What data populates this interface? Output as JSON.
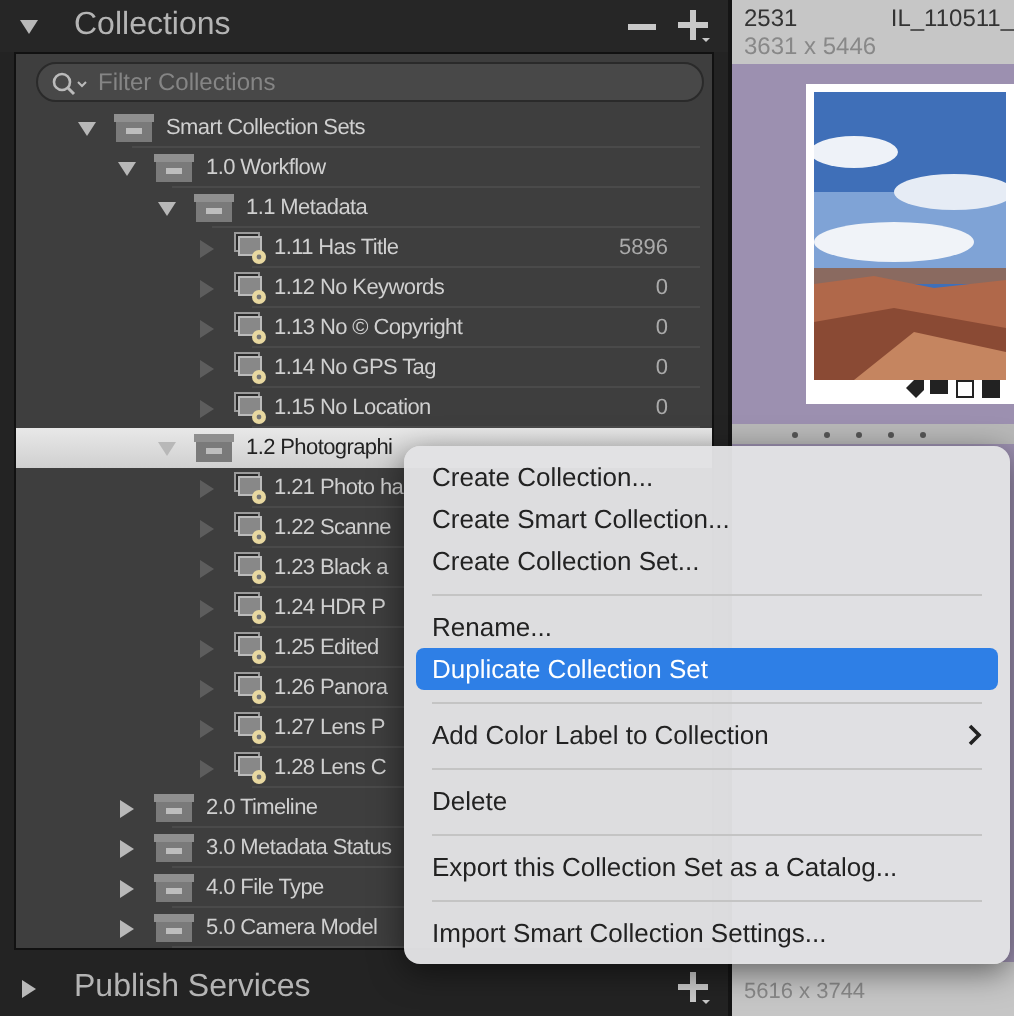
{
  "collections_panel": {
    "title": "Collections",
    "expanded": true,
    "filter": {
      "placeholder": "Filter Collections"
    },
    "tree": [
      {
        "kind": "set",
        "label": "Smart Collection Sets",
        "expanded": true,
        "selected": false,
        "children": [
          {
            "kind": "set",
            "label": "1.0 Workflow",
            "expanded": true,
            "selected": false,
            "children": [
              {
                "kind": "set",
                "label": "1.1 Metadata",
                "expanded": true,
                "selected": false,
                "children": [
                  {
                    "kind": "smart",
                    "label": "1.11 Has Title",
                    "count": "5896",
                    "selected": false
                  },
                  {
                    "kind": "smart",
                    "label": "1.12 No Keywords",
                    "count": "0",
                    "selected": false
                  },
                  {
                    "kind": "smart",
                    "label": "1.13 No © Copyright",
                    "count": "0",
                    "selected": false
                  },
                  {
                    "kind": "smart",
                    "label": "1.14 No GPS Tag",
                    "count": "0",
                    "selected": false
                  },
                  {
                    "kind": "smart",
                    "label": "1.15 No Location",
                    "count": "0",
                    "selected": false
                  }
                ]
              },
              {
                "kind": "set",
                "label": "1.2 Photographi",
                "expanded": true,
                "selected": true,
                "children": [
                  {
                    "kind": "smart",
                    "label": "1.21 Photo ha",
                    "selected": false
                  },
                  {
                    "kind": "smart",
                    "label": "1.22 Scanne",
                    "selected": false
                  },
                  {
                    "kind": "smart",
                    "label": "1.23 Black a",
                    "selected": false
                  },
                  {
                    "kind": "smart",
                    "label": "1.24 HDR P",
                    "selected": false
                  },
                  {
                    "kind": "smart",
                    "label": "1.25 Edited",
                    "selected": false
                  },
                  {
                    "kind": "smart",
                    "label": "1.26 Panora",
                    "selected": false
                  },
                  {
                    "kind": "smart",
                    "label": "1.27 Lens P",
                    "selected": false
                  },
                  {
                    "kind": "smart",
                    "label": "1.28 Lens C",
                    "selected": false
                  }
                ]
              }
            ]
          },
          {
            "kind": "set",
            "label": "2.0 Timeline",
            "expanded": false,
            "selected": false
          },
          {
            "kind": "set",
            "label": "3.0 Metadata Status",
            "expanded": false,
            "selected": false
          },
          {
            "kind": "set",
            "label": "4.0 File Type",
            "expanded": false,
            "selected": false
          },
          {
            "kind": "set",
            "label": "5.0 Camera Model",
            "expanded": false,
            "selected": false
          }
        ]
      }
    ]
  },
  "publish_panel": {
    "title": "Publish Services",
    "expanded": false
  },
  "grid": {
    "top_cell": {
      "index": "2531",
      "filename": "IL_110511_",
      "dimensions": "3631 x 5446"
    },
    "bottom_cell": {
      "dimensions": "5616 x 3744"
    }
  },
  "context_menu": {
    "groups": [
      [
        {
          "label": "Create Collection...",
          "selected": false,
          "submenu": false
        },
        {
          "label": "Create Smart Collection...",
          "selected": false,
          "submenu": false
        },
        {
          "label": "Create Collection Set...",
          "selected": false,
          "submenu": false
        }
      ],
      [
        {
          "label": "Rename...",
          "selected": false,
          "submenu": false
        },
        {
          "label": "Duplicate Collection Set",
          "selected": true,
          "submenu": false
        }
      ],
      [
        {
          "label": "Add Color Label to Collection",
          "selected": false,
          "submenu": true
        }
      ],
      [
        {
          "label": "Delete",
          "selected": false,
          "submenu": false
        }
      ],
      [
        {
          "label": "Export this Collection Set as a Catalog...",
          "selected": false,
          "submenu": false
        }
      ],
      [
        {
          "label": "Import Smart Collection Settings...",
          "selected": false,
          "submenu": false
        }
      ]
    ]
  }
}
